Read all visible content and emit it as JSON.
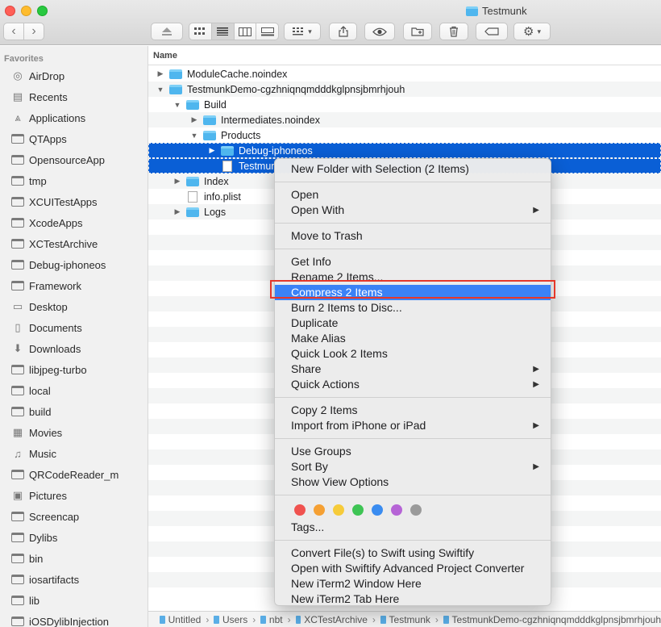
{
  "window": {
    "title": "Testmunk"
  },
  "toolbar": {
    "back_icon": "chevron-left-icon",
    "forward_icon": "chevron-right-icon",
    "eject_icon": "eject-icon",
    "share_icon": "share-icon",
    "quicklook_icon": "eye-icon",
    "newfolder_icon": "new-folder-icon",
    "trash_icon": "trash-icon",
    "tag_icon": "tag-icon",
    "action_icon": "gear-icon"
  },
  "sidebar": {
    "header": "Favorites",
    "items": [
      {
        "label": "AirDrop",
        "icon": "airdrop-icon"
      },
      {
        "label": "Recents",
        "icon": "recents-icon"
      },
      {
        "label": "Applications",
        "icon": "applications-icon"
      },
      {
        "label": "QTApps",
        "icon": "folder-icon"
      },
      {
        "label": "OpensourceApp",
        "icon": "folder-icon"
      },
      {
        "label": "tmp",
        "icon": "folder-icon"
      },
      {
        "label": "XCUITestApps",
        "icon": "folder-icon"
      },
      {
        "label": "XcodeApps",
        "icon": "folder-icon"
      },
      {
        "label": "XCTestArchive",
        "icon": "folder-icon"
      },
      {
        "label": "Debug-iphoneos",
        "icon": "folder-icon"
      },
      {
        "label": "Framework",
        "icon": "folder-icon"
      },
      {
        "label": "Desktop",
        "icon": "desktop-icon"
      },
      {
        "label": "Documents",
        "icon": "documents-icon"
      },
      {
        "label": "Downloads",
        "icon": "downloads-icon"
      },
      {
        "label": "libjpeg-turbo",
        "icon": "folder-icon"
      },
      {
        "label": "local",
        "icon": "folder-icon"
      },
      {
        "label": "build",
        "icon": "folder-icon"
      },
      {
        "label": "Movies",
        "icon": "movies-icon"
      },
      {
        "label": "Music",
        "icon": "music-icon"
      },
      {
        "label": "QRCodeReader_m",
        "icon": "folder-icon"
      },
      {
        "label": "Pictures",
        "icon": "pictures-icon"
      },
      {
        "label": "Screencap",
        "icon": "folder-icon"
      },
      {
        "label": "Dylibs",
        "icon": "folder-icon"
      },
      {
        "label": "bin",
        "icon": "folder-icon"
      },
      {
        "label": "iosartifacts",
        "icon": "folder-icon"
      },
      {
        "label": "lib",
        "icon": "folder-icon"
      },
      {
        "label": "iOSDylibInjection",
        "icon": "folder-icon"
      }
    ]
  },
  "list": {
    "column_name": "Name",
    "rows": [
      {
        "label": "ModuleCache.noindex",
        "level": 0,
        "disclosure": "collapsed",
        "kind": "folder"
      },
      {
        "label": "TestmunkDemo-cgzhniqnqmdddkglpnsjbmrhjouh",
        "level": 0,
        "disclosure": "expanded",
        "kind": "folder"
      },
      {
        "label": "Build",
        "level": 1,
        "disclosure": "expanded",
        "kind": "folder"
      },
      {
        "label": "Intermediates.noindex",
        "level": 2,
        "disclosure": "collapsed",
        "kind": "folder"
      },
      {
        "label": "Products",
        "level": 2,
        "disclosure": "expanded",
        "kind": "folder"
      },
      {
        "label": "Debug-iphoneos",
        "level": 3,
        "disclosure": "collapsed",
        "kind": "folder",
        "selected": true
      },
      {
        "label": "Testmun",
        "level": 3,
        "disclosure": "none",
        "kind": "file",
        "selected": true
      },
      {
        "label": "Index",
        "level": 1,
        "disclosure": "collapsed",
        "kind": "folder"
      },
      {
        "label": "info.plist",
        "level": 1,
        "disclosure": "none",
        "kind": "file"
      },
      {
        "label": "Logs",
        "level": 1,
        "disclosure": "collapsed",
        "kind": "folder"
      }
    ]
  },
  "context_menu": {
    "groups": [
      [
        {
          "label": "New Folder with Selection (2 Items)"
        }
      ],
      [
        {
          "label": "Open"
        },
        {
          "label": "Open With",
          "submenu": true
        }
      ],
      [
        {
          "label": "Move to Trash"
        }
      ],
      [
        {
          "label": "Get Info"
        },
        {
          "label": "Rename 2 Items..."
        },
        {
          "label": "Compress 2 Items",
          "highlighted": true
        },
        {
          "label": "Burn 2 Items to Disc..."
        },
        {
          "label": "Duplicate"
        },
        {
          "label": "Make Alias"
        },
        {
          "label": "Quick Look 2 Items"
        },
        {
          "label": "Share",
          "submenu": true
        },
        {
          "label": "Quick Actions",
          "submenu": true
        }
      ],
      [
        {
          "label": "Copy 2 Items"
        },
        {
          "label": "Import from iPhone or iPad",
          "submenu": true
        }
      ],
      [
        {
          "label": "Use Groups"
        },
        {
          "label": "Sort By",
          "submenu": true
        },
        {
          "label": "Show View Options"
        }
      ],
      [
        {
          "type": "tags"
        },
        {
          "label": "Tags..."
        }
      ],
      [
        {
          "label": "Convert File(s) to Swift using Swiftify"
        },
        {
          "label": "Open with Swiftify Advanced Project Converter"
        },
        {
          "label": "New iTerm2 Window Here"
        },
        {
          "label": "New iTerm2 Tab Here"
        }
      ]
    ],
    "tag_colors": [
      "#f0524f",
      "#f5a033",
      "#f6cb3a",
      "#3ec454",
      "#3a8cf0",
      "#b664d6",
      "#9a9a9a"
    ]
  },
  "pathbar": {
    "segments": [
      "Untitled",
      "Users",
      "nbt",
      "XCTestArchive",
      "Testmunk",
      "TestmunkDemo-cgzhniqnqmdddkglpnsjbmrhjouh"
    ]
  }
}
